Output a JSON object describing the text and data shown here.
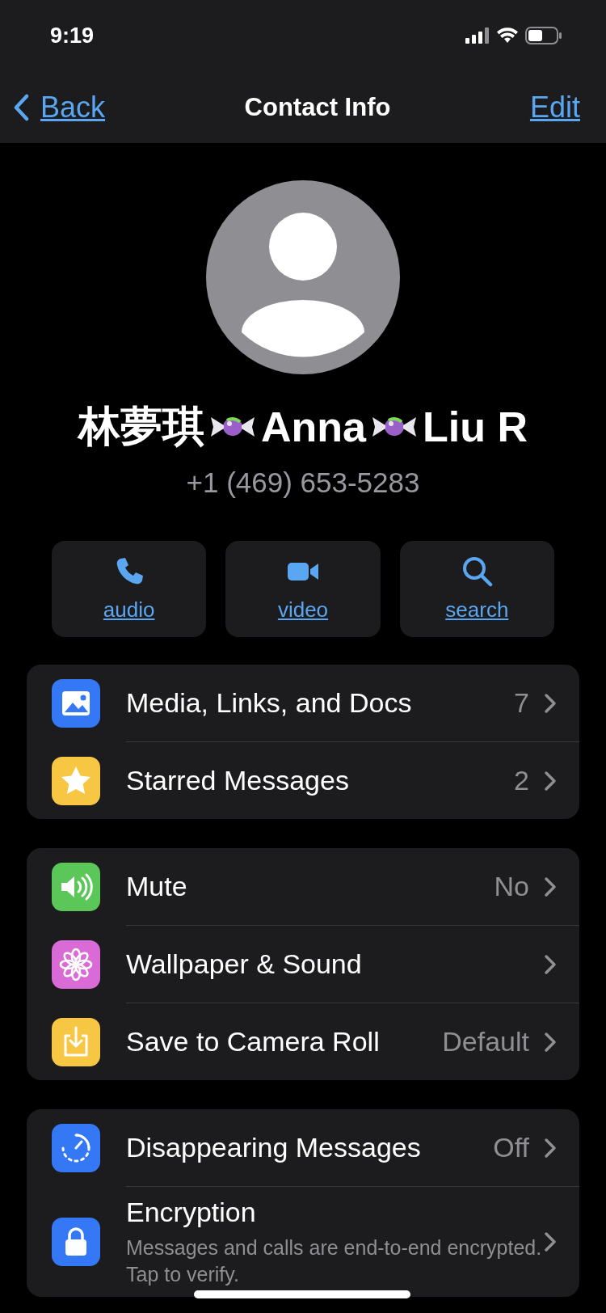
{
  "status_bar": {
    "time": "9:19"
  },
  "nav": {
    "back": "Back",
    "title": "Contact Info",
    "edit": "Edit"
  },
  "profile": {
    "name_parts": [
      "林夢琪",
      "Anna",
      "Liu R"
    ],
    "phone": "+1 (469) 653-5283"
  },
  "actions": [
    {
      "kind": "audio",
      "label": "audio"
    },
    {
      "kind": "video",
      "label": "video"
    },
    {
      "kind": "search",
      "label": "search"
    }
  ],
  "groups": [
    {
      "rows": [
        {
          "kind": "media",
          "title": "Media, Links, and Docs",
          "value": "7"
        },
        {
          "kind": "starred",
          "title": "Starred Messages",
          "value": "2"
        }
      ]
    },
    {
      "rows": [
        {
          "kind": "mute",
          "title": "Mute",
          "value": "No"
        },
        {
          "kind": "wallpaper",
          "title": "Wallpaper & Sound"
        },
        {
          "kind": "save",
          "title": "Save to Camera Roll",
          "value": "Default"
        }
      ]
    },
    {
      "rows": [
        {
          "kind": "disappearing",
          "title": "Disappearing Messages",
          "value": "Off"
        },
        {
          "kind": "encryption",
          "title": "Encryption",
          "subtitle": "Messages and calls are end-to-end encrypted. Tap to verify."
        }
      ]
    }
  ]
}
